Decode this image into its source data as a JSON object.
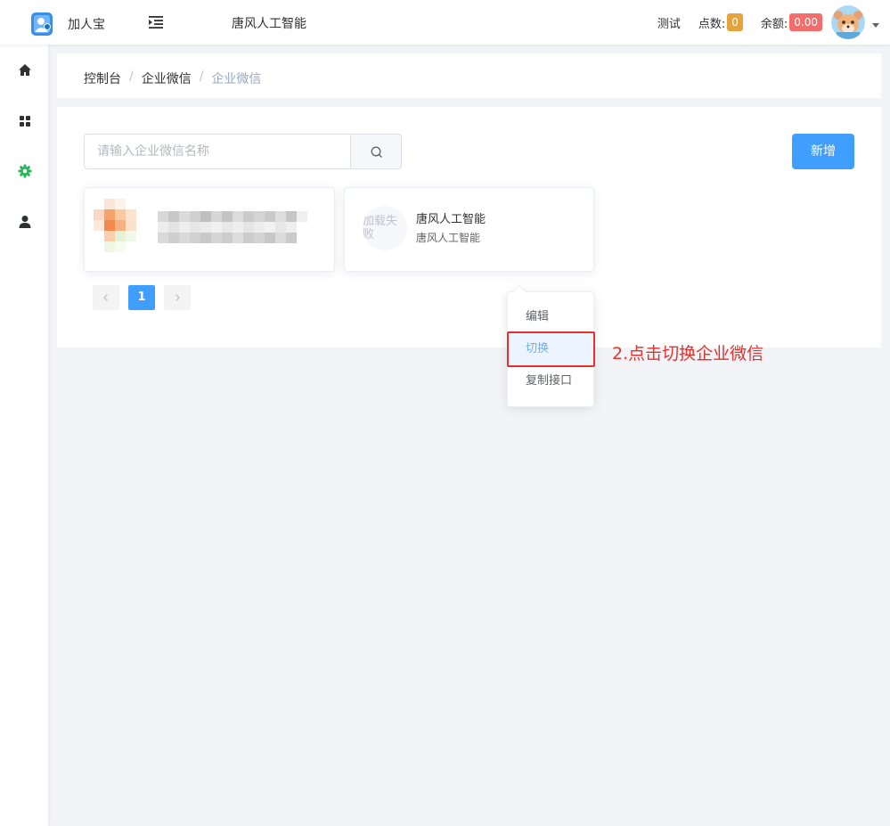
{
  "header": {
    "app_name": "加人宝",
    "tenant_name": "唐风人工智能",
    "test_label": "测试",
    "points_label": "点数:",
    "points_value": "0",
    "balance_label": "余额:",
    "balance_value": "0.00"
  },
  "sidebar": {
    "icons": [
      "home-icon",
      "grid-icon",
      "gear-icon",
      "user-icon"
    ],
    "active_index": 2
  },
  "breadcrumb": [
    "控制台",
    "企业微信",
    "企业微信"
  ],
  "search": {
    "placeholder": "请输入企业微信名称",
    "value": ""
  },
  "add_button": "新增",
  "cards": [
    {
      "title": "",
      "subtitle": ""
    },
    {
      "placeholder": "加载失败",
      "title": "唐风人工智能",
      "subtitle": "唐风人工智能"
    }
  ],
  "pagination": {
    "current": "1"
  },
  "dropdown": {
    "items": [
      "编辑",
      "切换",
      "复制接口"
    ],
    "highlighted_index": 1
  },
  "annotation": "2.点击切换企业微信",
  "colors": {
    "primary": "#409eff",
    "points_badge": "#e6a23c",
    "balance_badge": "#f56c6c",
    "annotation": "#e6302b",
    "active_menu": "#2db55d"
  }
}
